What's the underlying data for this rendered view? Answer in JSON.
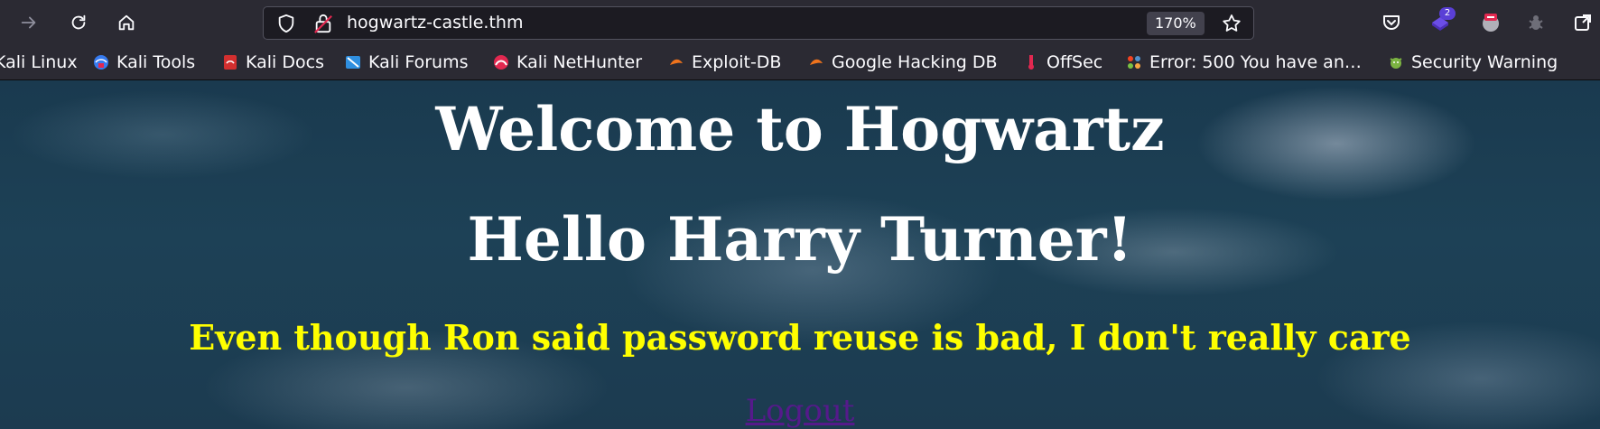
{
  "browser": {
    "url": "hogwartz-castle.thm",
    "zoom": "170%",
    "extension_badge": "2"
  },
  "bookmarks": [
    {
      "label": "Kali Linux",
      "icon": "kali-icon"
    },
    {
      "label": "Kali Tools",
      "icon": "kali-tools-icon"
    },
    {
      "label": "Kali Docs",
      "icon": "kali-docs-icon"
    },
    {
      "label": "Kali Forums",
      "icon": "kali-forums-icon"
    },
    {
      "label": "Kali NetHunter",
      "icon": "nethunter-icon"
    },
    {
      "label": "Exploit-DB",
      "icon": "exploit-db-icon"
    },
    {
      "label": "Google Hacking DB",
      "icon": "ghdb-icon"
    },
    {
      "label": "OffSec",
      "icon": "offsec-icon"
    },
    {
      "label": "Error: 500 You have an…",
      "icon": "joomla-icon"
    },
    {
      "label": "Security Warning",
      "icon": "security-warning-icon"
    }
  ],
  "page": {
    "heading1": "Welcome to Hogwartz",
    "heading2": "Hello Harry Turner!",
    "message": "Even though Ron said password reuse is bad, I don't really care",
    "logout_label": "Logout"
  },
  "colors": {
    "message": "#ffff00",
    "link": "#551a8b",
    "heading": "#ffffff"
  }
}
